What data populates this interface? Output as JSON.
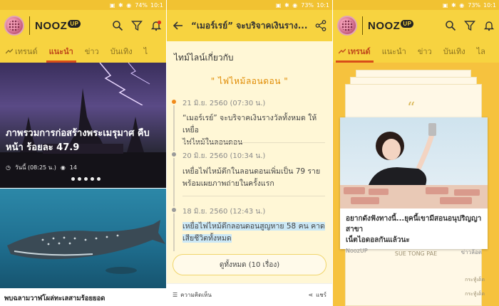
{
  "status": {
    "left": {
      "battery": "74%",
      "time": "10:1"
    },
    "mid": {
      "battery": "73%",
      "time": "10:1"
    },
    "right": {
      "battery": "73%",
      "time": "10:1"
    }
  },
  "app": {
    "logo_text": "NOOZ",
    "logo_badge": "UP"
  },
  "tabs_home": [
    {
      "label": "เทรนด์"
    },
    {
      "label": "แนะนำ"
    },
    {
      "label": "ข่าว"
    },
    {
      "label": "บันเทิง"
    },
    {
      "label": "ไ"
    }
  ],
  "tabs_trend": [
    {
      "label": "เทรนด์"
    },
    {
      "label": "แนะนำ"
    },
    {
      "label": "ข่าว"
    },
    {
      "label": "บันเทิง"
    },
    {
      "label": "ไล"
    }
  ],
  "feed": {
    "hero_title": "ภาพรวมการก่อสร้างพระเมรุมาศ คืบหน้า ร้อยละ 47.9",
    "hero_time": "วันนี้ (08:25 น.)",
    "hero_views": "14",
    "carousel_pages": 5,
    "carousel_active": 0,
    "second_title": "พบฉลามวาฬโผล่ทะเลสามร้อยยอด"
  },
  "detail": {
    "title": "“เมอร์เรย์” จะบริจาคเงินราง...",
    "section_title": "ไทม์ไลน์เกี่ยวกับ",
    "topic": "\" ไฟไหม้ลอนดอน \"",
    "items": [
      {
        "date": "21 มิ.ย. 2560 (07:30 น.)",
        "line1": "“เมอร์เรย์” จะบริจาคเงินรางวัลทั้งหมด ให้เหยื่อ",
        "line2": "ไฟไหม้ในลอนดอน"
      },
      {
        "date": "20 มิ.ย. 2560 (10:34 น.)",
        "line1": "เหยื่อไฟไหม้ตึกในลอนดอนเพิ่มเป็น 79 ราย",
        "line2": "พร้อมเผยภาพถ่ายในครั้งแรก"
      },
      {
        "date": "18 มิ.ย. 2560 (12:43 น.)",
        "line1": "เหยื่อไฟไหม้ตึกลอนดอนสูญหาย 58 คน คาด",
        "line2": "เสียชีวิตทั้งหมด"
      }
    ],
    "view_all": "ดูทั้งหมด (10 เรื่อง)",
    "comment_label": "ความคิดเห็น",
    "share_label": "แชร์"
  },
  "trend": {
    "card_title_line1": "อยากดังฟังทางนี้...ยุคนี้เขามีสอนอนุปริญญาสาขา",
    "card_title_line2": "เน็ตไอดอลกันแล้วนะ",
    "card_source": "NoozUP",
    "card_category": "ข่าวล้อต",
    "sub_caption": "SUE TONG PAE",
    "credit1": "กระทู้เด็ด",
    "credit2": "กระทู้เด็ด"
  },
  "colors": {
    "brand_yellow": "#f7d340",
    "accent_orange": "#d84d19",
    "timeline_orange": "#f08a1b"
  }
}
